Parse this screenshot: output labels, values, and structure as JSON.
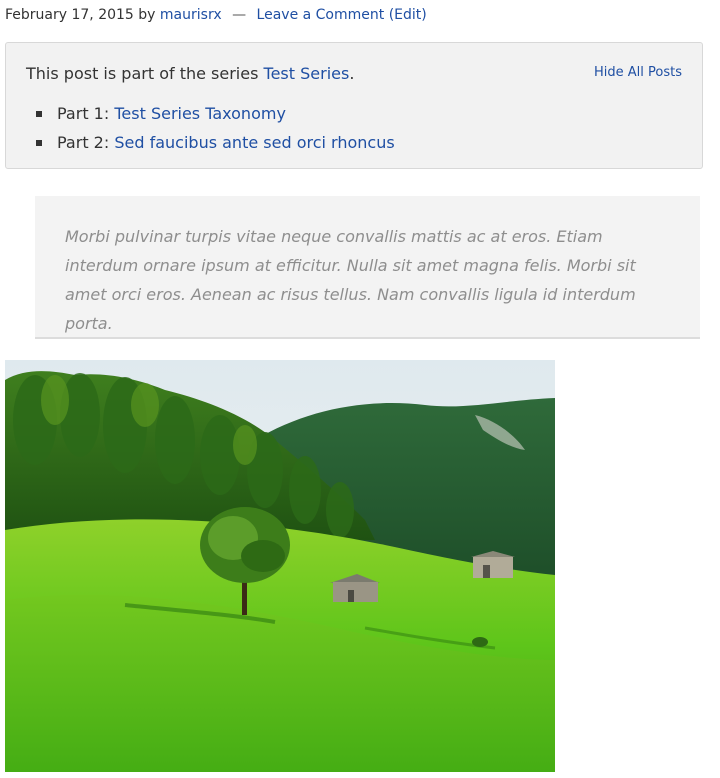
{
  "post_meta": {
    "date": "February 17, 2015",
    "by_text": "by",
    "author": "maurisrx",
    "separator": "—",
    "comment_link": "Leave a Comment",
    "edit_link": "(Edit)"
  },
  "series_box": {
    "intro_prefix": "This post is part of the series",
    "series_name": "Test Series",
    "intro_suffix": ".",
    "hide_all_label": "Hide All Posts",
    "parts": [
      {
        "prefix": "Part 1:",
        "title": "Test Series Taxonomy"
      },
      {
        "prefix": "Part 2:",
        "title": "Sed faucibus ante sed orci rhoncus"
      }
    ]
  },
  "blockquote": {
    "text": "Morbi pulvinar turpis vitae neque convallis mattis ac at eros. Etiam interdum ornare ipsum at efficitur. Nulla sit amet magna felis. Morbi sit amet orci eros. Aenean ac risus tellus. Nam convallis ligula id interdum porta."
  },
  "colors": {
    "link": "#1f4fa3",
    "box_background": "#f2f2f2",
    "quote_text": "#8e8e8e"
  },
  "image": {
    "description_icon": "landscape-photo"
  }
}
